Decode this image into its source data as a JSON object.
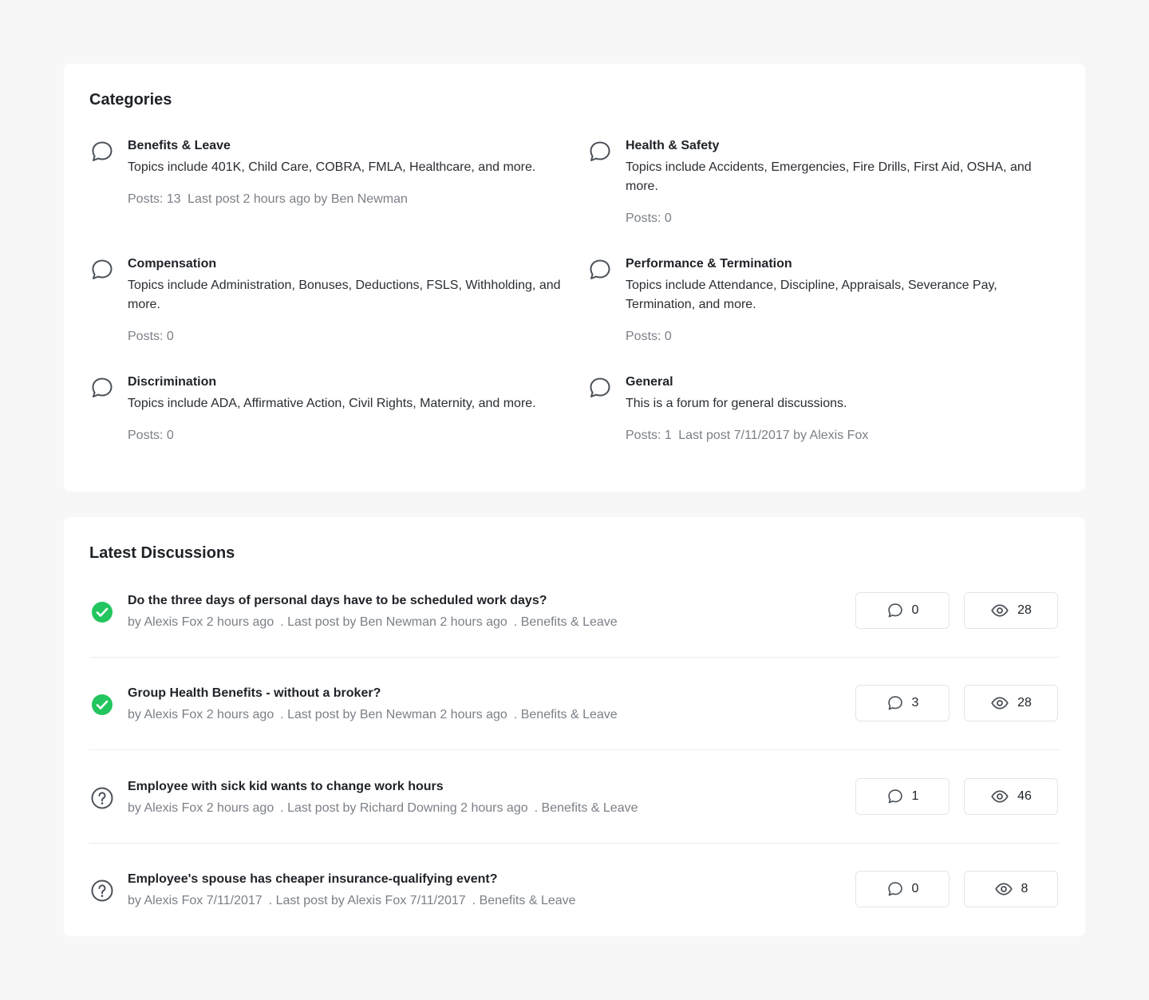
{
  "categories": {
    "title": "Categories",
    "items": [
      {
        "name": "Benefits & Leave",
        "description": "Topics include 401K, Child Care, COBRA, FMLA, Healthcare, and more.",
        "posts": "Posts: 13",
        "last_post": "Last post 2 hours ago by Ben Newman"
      },
      {
        "name": "Health & Safety",
        "description": "Topics include Accidents, Emergencies, Fire Drills, First Aid, OSHA, and more.",
        "posts": "Posts: 0",
        "last_post": ""
      },
      {
        "name": "Compensation",
        "description": "Topics include Administration, Bonuses, Deductions, FSLS, Withholding, and more.",
        "posts": "Posts: 0",
        "last_post": ""
      },
      {
        "name": "Performance & Termination",
        "description": "Topics include Attendance, Discipline, Appraisals, Severance Pay, Termination, and more.",
        "posts": "Posts: 0",
        "last_post": ""
      },
      {
        "name": "Discrimination",
        "description": "Topics include ADA, Affirmative Action, Civil Rights, Maternity, and more.",
        "posts": "Posts: 0",
        "last_post": ""
      },
      {
        "name": "General",
        "description": "This is a forum for general discussions.",
        "posts": "Posts: 1",
        "last_post": "Last post 7/11/2017 by Alexis Fox"
      }
    ]
  },
  "discussions": {
    "title": "Latest Discussions",
    "items": [
      {
        "title": "Do the three days of personal days have to be scheduled work days?",
        "status": "answered",
        "author": "by Alexis Fox 2 hours ago",
        "last_post": ". Last post by Ben Newman 2 hours ago",
        "category": ". Benefits & Leave",
        "replies": "0",
        "views": "28"
      },
      {
        "title": "Group Health Benefits - without a broker?",
        "status": "answered",
        "author": "by Alexis Fox 2 hours ago",
        "last_post": ". Last post by Ben Newman 2 hours ago",
        "category": ". Benefits & Leave",
        "replies": "3",
        "views": "28"
      },
      {
        "title": "Employee with sick kid wants to change work hours",
        "status": "question",
        "author": "by Alexis Fox 2 hours ago",
        "last_post": ". Last post by Richard Downing 2 hours ago",
        "category": ". Benefits & Leave",
        "replies": "1",
        "views": "46"
      },
      {
        "title": "Employee's spouse has cheaper insurance-qualifying event?",
        "status": "question",
        "author": "by Alexis Fox 7/11/2017",
        "last_post": ". Last post by Alexis Fox 7/11/2017",
        "category": ". Benefits & Leave",
        "replies": "0",
        "views": "8"
      }
    ]
  },
  "colors": {
    "accent_green": "#22c55e",
    "icon_gray": "#4b5158",
    "muted_text": "#7b8087"
  },
  "icons": {
    "category": "chat-bubble-icon",
    "answered": "check-circle-icon",
    "question": "question-circle-icon",
    "replies": "chat-bubble-icon",
    "views": "eye-icon"
  }
}
